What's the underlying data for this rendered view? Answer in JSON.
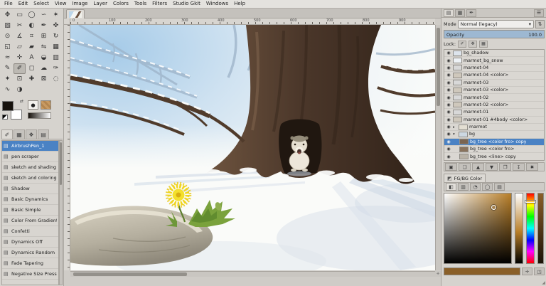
{
  "menubar": {
    "items": [
      "File",
      "Edit",
      "Select",
      "View",
      "Image",
      "Layer",
      "Colors",
      "Tools",
      "Filters",
      "Studio Gkit",
      "Windows",
      "Help"
    ]
  },
  "icons": {
    "swap": "⇄",
    "chevron_down": "▾",
    "mode_switch": "⇅",
    "lock_pixels": "✐",
    "lock_position": "✥",
    "lock_alpha": "▦",
    "nav": "✛",
    "grip": "◢",
    "brush_dot": "●",
    "color_tab": "◩",
    "picker": "✛",
    "reset": "◳",
    "eye": "◉",
    "group_collapsed": "▸",
    "group_expanded": "▾",
    "dyn_item": "▤"
  },
  "toolbox": {
    "selected": "paintbrush",
    "fg_color": "#17120d",
    "bg_color": "#ffffff",
    "tools": [
      {
        "name": "move",
        "glyph": "✥"
      },
      {
        "name": "rectangle-select",
        "glyph": "▭"
      },
      {
        "name": "ellipse-select",
        "glyph": "◯"
      },
      {
        "name": "free-select",
        "glyph": "∽"
      },
      {
        "name": "fuzzy-select",
        "glyph": "✶"
      },
      {
        "name": "select-by-color",
        "glyph": "▧"
      },
      {
        "name": "scissors-select",
        "glyph": "✂"
      },
      {
        "name": "foreground-select",
        "glyph": "◐"
      },
      {
        "name": "paths",
        "glyph": "✒"
      },
      {
        "name": "color-picker",
        "glyph": "✜"
      },
      {
        "name": "zoom",
        "glyph": "⊙"
      },
      {
        "name": "measure",
        "glyph": "∡"
      },
      {
        "name": "crop",
        "glyph": "⌗"
      },
      {
        "name": "unified-transform",
        "glyph": "⊞"
      },
      {
        "name": "rotate",
        "glyph": "↻"
      },
      {
        "name": "scale",
        "glyph": "◱"
      },
      {
        "name": "shear",
        "glyph": "▱"
      },
      {
        "name": "perspective",
        "glyph": "▰"
      },
      {
        "name": "flip",
        "glyph": "⇋"
      },
      {
        "name": "cage-transform",
        "glyph": "▦"
      },
      {
        "name": "warp-transform",
        "glyph": "≈"
      },
      {
        "name": "handle-transform",
        "glyph": "✛"
      },
      {
        "name": "text",
        "glyph": "A"
      },
      {
        "name": "bucket-fill",
        "glyph": "◒"
      },
      {
        "name": "gradient",
        "glyph": "▥"
      },
      {
        "name": "pencil",
        "glyph": "✎"
      },
      {
        "name": "paintbrush",
        "glyph": "✐"
      },
      {
        "name": "eraser",
        "glyph": "◻"
      },
      {
        "name": "airbrush",
        "glyph": "☁"
      },
      {
        "name": "ink",
        "glyph": "✑"
      },
      {
        "name": "mypaint-brush",
        "glyph": "✦"
      },
      {
        "name": "clone",
        "glyph": "⊡"
      },
      {
        "name": "heal",
        "glyph": "✚"
      },
      {
        "name": "perspective-clone",
        "glyph": "⊠"
      },
      {
        "name": "blur-sharpen",
        "glyph": "◌"
      },
      {
        "name": "smudge",
        "glyph": "∿"
      },
      {
        "name": "dodge-burn",
        "glyph": "◑"
      }
    ]
  },
  "dock_tabs_left": [
    {
      "name": "tool-options",
      "glyph": "✐",
      "active": true
    },
    {
      "name": "device-status",
      "glyph": "▦",
      "active": false
    },
    {
      "name": "dynamics",
      "glyph": "❖",
      "active": false
    },
    {
      "name": "brushes",
      "glyph": "▤",
      "active": false
    }
  ],
  "dynamics": {
    "selected": 0,
    "items": [
      "AirbrushPen_1",
      "pen scraper",
      "sketch and shading ink",
      "sketch and coloring pen",
      "Shadow",
      "Basic Dynamics",
      "Basic Simple",
      "Color From Gradient",
      "Confetti",
      "Dynamics Off",
      "Dynamics Random",
      "Fade Tapering",
      "Negative Size Pressure"
    ]
  },
  "rulers": {
    "h_labels": [
      "0",
      "100",
      "200",
      "300",
      "400",
      "500",
      "600",
      "700",
      "800",
      "900"
    ]
  },
  "layers_panel": {
    "dock_tabs": [
      {
        "name": "layers",
        "glyph": "▤",
        "active": true
      },
      {
        "name": "channels",
        "glyph": "▦",
        "active": false
      },
      {
        "name": "paths",
        "glyph": "✒",
        "active": false
      },
      {
        "name": "dock-menu",
        "glyph": "☰",
        "active": false,
        "last": true
      }
    ],
    "mode_label": "Mode",
    "mode_value": "Normal (legacy)",
    "opacity_label": "Opacity",
    "opacity_value": "100.0",
    "opacity_percent": 100,
    "lock_label": "Lock:",
    "items": [
      {
        "name": "bg_shadow",
        "thumb": "#dde4ec"
      },
      {
        "name": "marmot_bg_snow",
        "thumb": "#eef2f6"
      },
      {
        "name": "marmot-04",
        "thumb": "#d8d8d8"
      },
      {
        "name": "marmot-04 <color>",
        "thumb": "#cfc8bc"
      },
      {
        "name": "marmot-03",
        "thumb": "#d8d8d8"
      },
      {
        "name": "marmot-03 <color>",
        "thumb": "#cfc8bc"
      },
      {
        "name": "marmot-02",
        "thumb": "#d8d8d8"
      },
      {
        "name": "marmot-02 <color>",
        "thumb": "#cfc8bc"
      },
      {
        "name": "marmot-01",
        "thumb": "#d8d8d8"
      },
      {
        "name": "marmot-01 #4body <color>",
        "thumb": "#cfc8bc"
      },
      {
        "name": "marmot",
        "group": true,
        "thumb": "#e3ded2"
      },
      {
        "name": "bg",
        "group": true,
        "expanded": true,
        "thumb": "#cdd8e2"
      },
      {
        "name": "bg_tree <color fro> copy",
        "selected": true,
        "indent": 1,
        "thumb": "#7a6450"
      },
      {
        "name": "bg_tree <color fro>",
        "indent": 1,
        "thumb": "#8a735c"
      },
      {
        "name": "bg_tree <line> copy",
        "indent": 1,
        "thumb": "#b9b2a6"
      }
    ],
    "toolbar": [
      {
        "name": "new-layer",
        "glyph": "▣"
      },
      {
        "name": "new-group",
        "glyph": "❑"
      },
      {
        "name": "raise-layer",
        "glyph": "▲"
      },
      {
        "name": "lower-layer",
        "glyph": "▼"
      },
      {
        "name": "duplicate-layer",
        "glyph": "❐"
      },
      {
        "name": "anchor-layer",
        "glyph": "↧"
      },
      {
        "name": "delete-layer",
        "glyph": "✖"
      }
    ]
  },
  "color_panel": {
    "tab_label": "FG/BG Color",
    "selector_tabs": [
      {
        "name": "gimp-selector",
        "glyph": "◧",
        "active": true
      },
      {
        "name": "cmyk-selector",
        "glyph": "▥",
        "active": false
      },
      {
        "name": "watercolor-selector",
        "glyph": "◔",
        "active": false
      },
      {
        "name": "wheel-selector",
        "glyph": "◯",
        "active": false
      },
      {
        "name": "palette-selector",
        "glyph": "▤",
        "active": false
      }
    ],
    "hue_hex": "#b97f28",
    "current_hex": "#8a5f28"
  }
}
